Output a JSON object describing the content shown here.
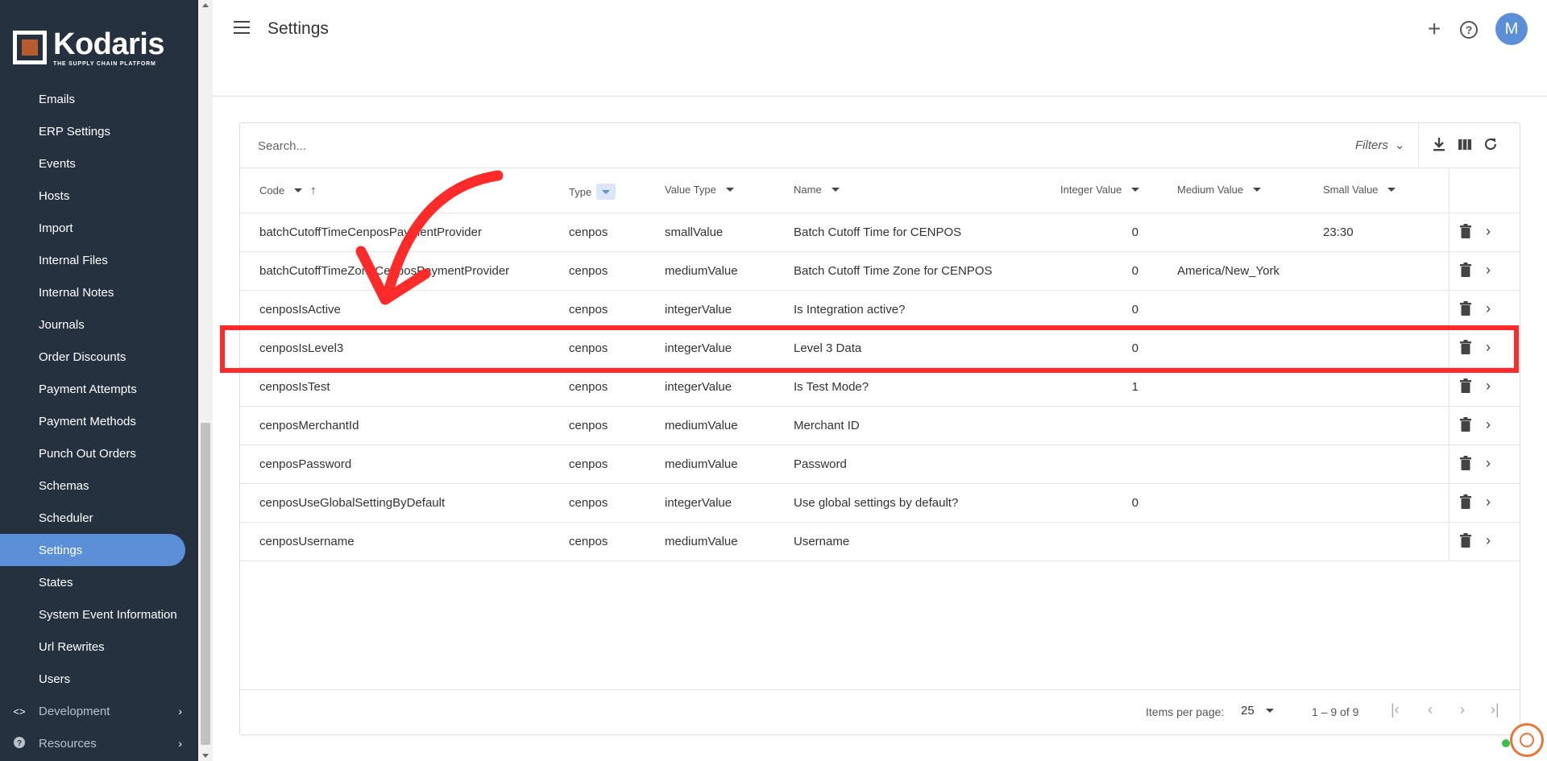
{
  "app": {
    "brand": "Kodaris",
    "tagline": "THE SUPPLY CHAIN PLATFORM",
    "brand_color": "#b85c2e",
    "accent_color": "#5b8fd8",
    "sidebar_bg": "#263140"
  },
  "sidebar": {
    "items": [
      {
        "label": "Emails"
      },
      {
        "label": "ERP Settings"
      },
      {
        "label": "Events"
      },
      {
        "label": "Hosts"
      },
      {
        "label": "Import"
      },
      {
        "label": "Internal Files"
      },
      {
        "label": "Internal Notes"
      },
      {
        "label": "Journals"
      },
      {
        "label": "Order Discounts"
      },
      {
        "label": "Payment Attempts"
      },
      {
        "label": "Payment Methods"
      },
      {
        "label": "Punch Out Orders"
      },
      {
        "label": "Schemas"
      },
      {
        "label": "Scheduler"
      },
      {
        "label": "Settings",
        "active": true
      },
      {
        "label": "States"
      },
      {
        "label": "System Event Information"
      },
      {
        "label": "Url Rewrites"
      },
      {
        "label": "Users"
      }
    ],
    "groups": [
      {
        "label": "Development",
        "icon": "code-icon"
      },
      {
        "label": "Resources",
        "icon": "help-circle-icon"
      }
    ]
  },
  "header": {
    "title": "Settings",
    "avatar_initial": "M",
    "add_icon": "plus-icon",
    "help_icon": "help-icon"
  },
  "toolbar": {
    "search_placeholder": "Search...",
    "filters_label": "Filters"
  },
  "table": {
    "columns": {
      "code": "Code",
      "type": "Type",
      "value_type": "Value Type",
      "name": "Name",
      "integer_value": "Integer Value",
      "medium_value": "Medium Value",
      "small_value": "Small Value"
    },
    "rows": [
      {
        "code": "batchCutoffTimeCenposPaymentProvider",
        "type": "cenpos",
        "value_type": "smallValue",
        "name": "Batch Cutoff Time for CENPOS",
        "integer_value": "0",
        "medium_value": "",
        "small_value": "23:30"
      },
      {
        "code": "batchCutoffTimeZoneCenposPaymentProvider",
        "type": "cenpos",
        "value_type": "mediumValue",
        "name": "Batch Cutoff Time Zone for CENPOS",
        "integer_value": "0",
        "medium_value": "America/New_York",
        "small_value": ""
      },
      {
        "code": "cenposIsActive",
        "type": "cenpos",
        "value_type": "integerValue",
        "name": "Is Integration active?",
        "integer_value": "0",
        "medium_value": "",
        "small_value": ""
      },
      {
        "code": "cenposIsLevel3",
        "type": "cenpos",
        "value_type": "integerValue",
        "name": "Level 3 Data",
        "integer_value": "0",
        "medium_value": "",
        "small_value": ""
      },
      {
        "code": "cenposIsTest",
        "type": "cenpos",
        "value_type": "integerValue",
        "name": "Is Test Mode?",
        "integer_value": "1",
        "medium_value": "",
        "small_value": ""
      },
      {
        "code": "cenposMerchantId",
        "type": "cenpos",
        "value_type": "mediumValue",
        "name": "Merchant ID",
        "integer_value": "",
        "medium_value": "",
        "small_value": ""
      },
      {
        "code": "cenposPassword",
        "type": "cenpos",
        "value_type": "mediumValue",
        "name": "Password",
        "integer_value": "",
        "medium_value": "",
        "small_value": ""
      },
      {
        "code": "cenposUseGlobalSettingByDefault",
        "type": "cenpos",
        "value_type": "integerValue",
        "name": "Use global settings by default?",
        "integer_value": "0",
        "medium_value": "",
        "small_value": ""
      },
      {
        "code": "cenposUsername",
        "type": "cenpos",
        "value_type": "mediumValue",
        "name": "Username",
        "integer_value": "",
        "medium_value": "",
        "small_value": ""
      }
    ]
  },
  "pagination": {
    "items_per_page_label": "Items per page:",
    "items_per_page": "25",
    "range": "1 – 9 of 9"
  },
  "annotation": {
    "highlight_color": "#ff2a2a",
    "highlighted_row": "cenposIsLevel3"
  }
}
